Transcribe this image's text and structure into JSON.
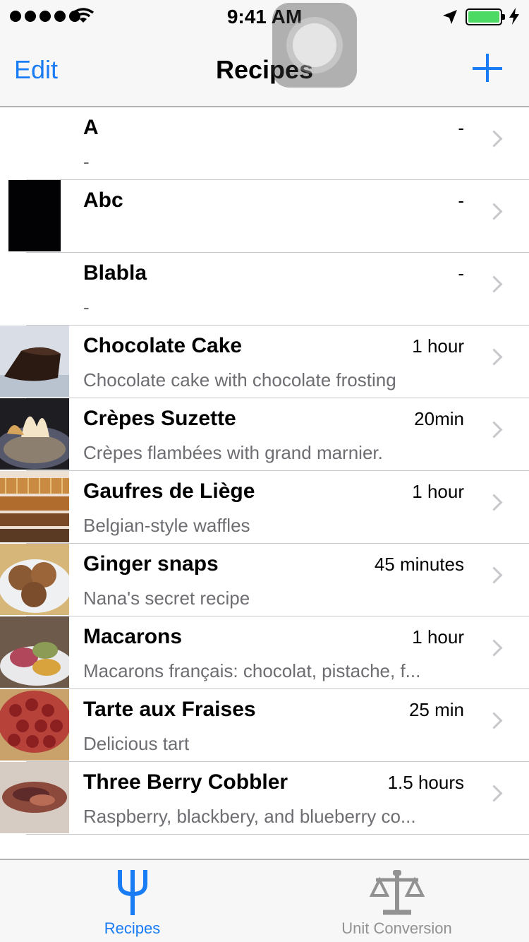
{
  "status_bar": {
    "time": "9:41 AM",
    "battery_color": "#4cd964"
  },
  "nav": {
    "edit_label": "Edit",
    "title": "Recipes",
    "add_icon": "plus-icon",
    "accent_color": "#1a7cf5"
  },
  "recipes": [
    {
      "title": "A",
      "time": "-",
      "subtitle": "-",
      "thumb": "none"
    },
    {
      "title": "Abc",
      "time": "-",
      "subtitle": "",
      "thumb": "black"
    },
    {
      "title": "Blabla",
      "time": "-",
      "subtitle": "-",
      "thumb": "none"
    },
    {
      "title": "Chocolate Cake",
      "time": "1 hour",
      "subtitle": "Chocolate cake with chocolate frosting",
      "thumb": "chocolate-cake"
    },
    {
      "title": "Crèpes Suzette",
      "time": "20min",
      "subtitle": "Crèpes flambées with grand marnier.",
      "thumb": "crepes"
    },
    {
      "title": "Gaufres de Liège",
      "time": "1 hour",
      "subtitle": "Belgian-style waffles",
      "thumb": "waffles"
    },
    {
      "title": "Ginger snaps",
      "time": "45 minutes",
      "subtitle": "Nana's secret recipe",
      "thumb": "ginger-snaps"
    },
    {
      "title": "Macarons",
      "time": "1 hour",
      "subtitle": "Macarons français: chocolat, pistache, f...",
      "thumb": "macarons"
    },
    {
      "title": "Tarte aux Fraises",
      "time": "25 min",
      "subtitle": "Delicious tart",
      "thumb": "tart"
    },
    {
      "title": "Three Berry Cobbler",
      "time": "1.5 hours",
      "subtitle": "Raspberry, blackbery, and blueberry co...",
      "thumb": "cobbler"
    }
  ],
  "tabs": [
    {
      "label": "Recipes",
      "icon": "fork-icon",
      "active": true
    },
    {
      "label": "Unit Conversion",
      "icon": "scale-icon",
      "active": false
    }
  ]
}
